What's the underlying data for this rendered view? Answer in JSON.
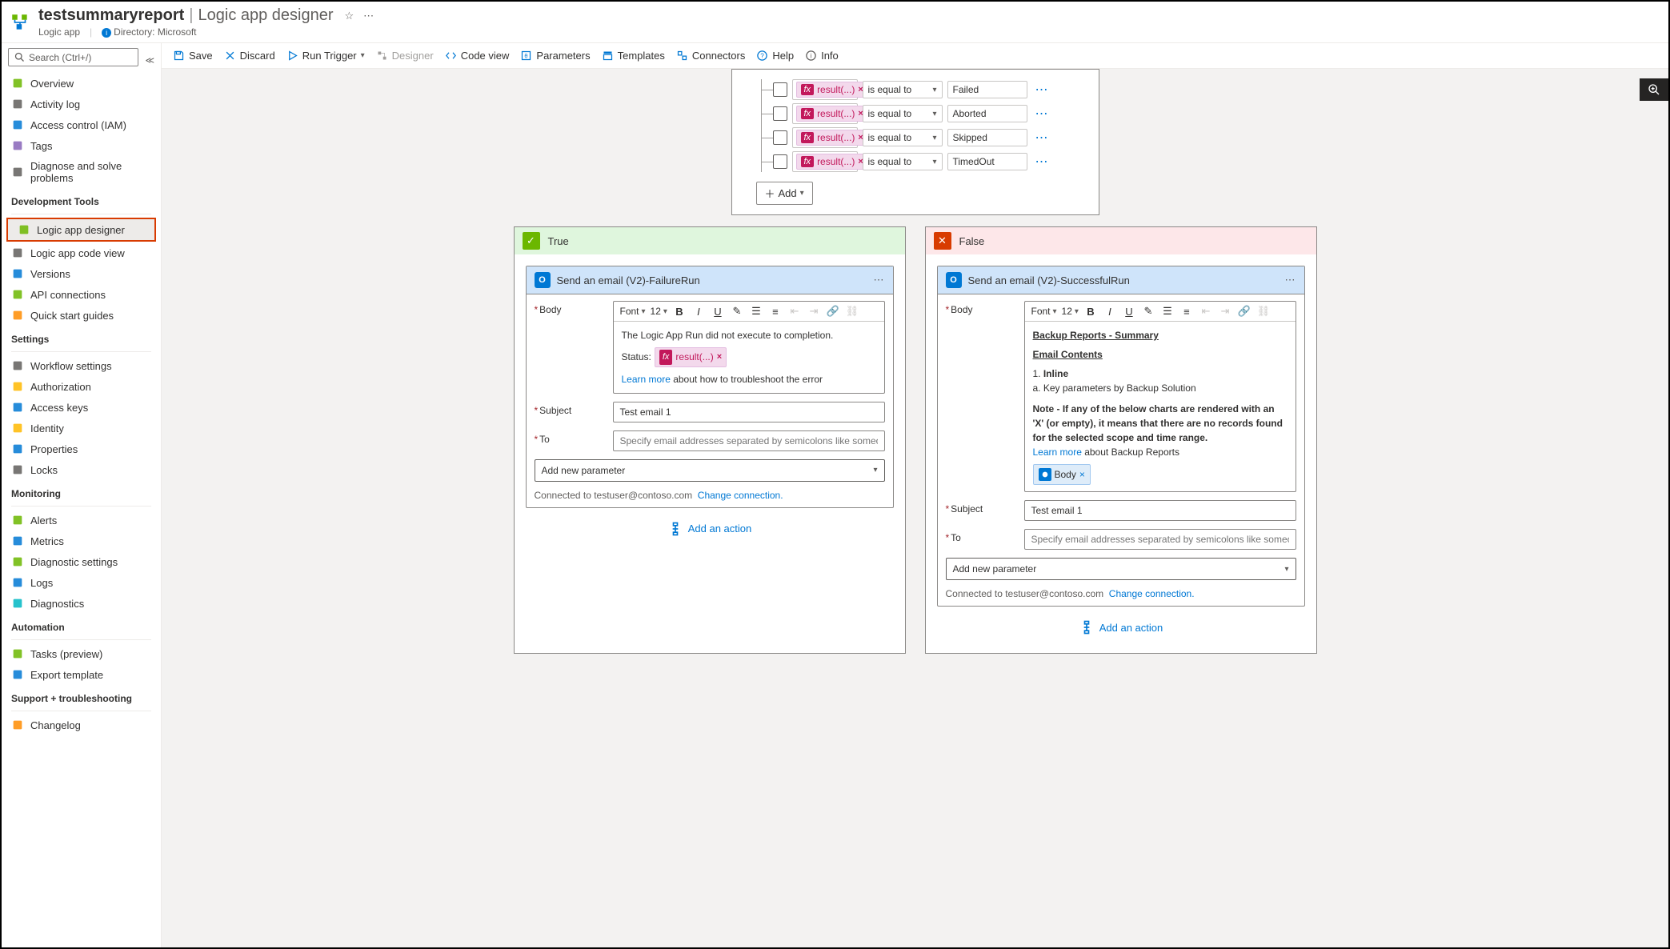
{
  "header": {
    "app_name": "testsummaryreport",
    "page_title": "Logic app designer",
    "resource_type": "Logic app",
    "directory_label": "Directory: Microsoft"
  },
  "sidebar": {
    "search_placeholder": "Search (Ctrl+/)",
    "items_top": [
      {
        "icon": "overview",
        "label": "Overview",
        "color": "#6bb700"
      },
      {
        "icon": "activity",
        "label": "Activity log",
        "color": "#605e5c"
      },
      {
        "icon": "iam",
        "label": "Access control (IAM)",
        "color": "#0078d4"
      },
      {
        "icon": "tags",
        "label": "Tags",
        "color": "#8764b8"
      },
      {
        "icon": "diagnose",
        "label": "Diagnose and solve problems",
        "color": "#605e5c"
      }
    ],
    "section_dev": "Development Tools",
    "items_dev": [
      {
        "icon": "designer",
        "label": "Logic app designer",
        "active": true,
        "color": "#6bb700"
      },
      {
        "icon": "code",
        "label": "Logic app code view",
        "color": "#605e5c"
      },
      {
        "icon": "versions",
        "label": "Versions",
        "color": "#0078d4"
      },
      {
        "icon": "api",
        "label": "API connections",
        "color": "#6bb700"
      },
      {
        "icon": "guides",
        "label": "Quick start guides",
        "color": "#ff8c00"
      }
    ],
    "section_settings": "Settings",
    "items_settings": [
      {
        "icon": "workflow",
        "label": "Workflow settings",
        "color": "#605e5c"
      },
      {
        "icon": "auth",
        "label": "Authorization",
        "color": "#ffb900"
      },
      {
        "icon": "keys",
        "label": "Access keys",
        "color": "#0078d4"
      },
      {
        "icon": "identity",
        "label": "Identity",
        "color": "#ffb900"
      },
      {
        "icon": "props",
        "label": "Properties",
        "color": "#0078d4"
      },
      {
        "icon": "locks",
        "label": "Locks",
        "color": "#605e5c"
      }
    ],
    "section_monitor": "Monitoring",
    "items_monitor": [
      {
        "icon": "alerts",
        "label": "Alerts",
        "color": "#6bb700"
      },
      {
        "icon": "metrics",
        "label": "Metrics",
        "color": "#0078d4"
      },
      {
        "icon": "diagset",
        "label": "Diagnostic settings",
        "color": "#6bb700"
      },
      {
        "icon": "logs",
        "label": "Logs",
        "color": "#0078d4"
      },
      {
        "icon": "diag",
        "label": "Diagnostics",
        "color": "#00b7c3"
      }
    ],
    "section_auto": "Automation",
    "items_auto": [
      {
        "icon": "tasks",
        "label": "Tasks (preview)",
        "color": "#6bb700"
      },
      {
        "icon": "export",
        "label": "Export template",
        "color": "#0078d4"
      }
    ],
    "section_support": "Support + troubleshooting",
    "items_support": [
      {
        "icon": "changelog",
        "label": "Changelog",
        "color": "#ff8c00"
      }
    ]
  },
  "toolbar": {
    "save": "Save",
    "discard": "Discard",
    "run": "Run Trigger",
    "designer": "Designer",
    "codeview": "Code view",
    "params": "Parameters",
    "templates": "Templates",
    "connectors": "Connectors",
    "help": "Help",
    "info": "Info"
  },
  "condition": {
    "token": "result(...)",
    "op": "is equal to",
    "rows": [
      {
        "value": "Failed"
      },
      {
        "value": "Aborted"
      },
      {
        "value": "Skipped"
      },
      {
        "value": "TimedOut"
      }
    ],
    "add": "Add"
  },
  "branch_true": {
    "label": "True",
    "action_title": "Send an email (V2)-FailureRun",
    "body_label": "Body",
    "subject_label": "Subject",
    "to_label": "To",
    "font_label": "Font",
    "font_size": "12",
    "body_text1": "The Logic App Run did not execute to completion.",
    "body_status_prefix": "Status:",
    "body_token": "result(...)",
    "body_learn_more": "Learn more",
    "body_text2": " about how to troubleshoot the error",
    "subject_value": "Test email 1",
    "to_placeholder": "Specify email addresses separated by semicolons like someone@contoso.com",
    "add_param": "Add new parameter",
    "connected": "Connected to testuser@contoso.com",
    "change_conn": "Change connection.",
    "add_action": "Add an action"
  },
  "branch_false": {
    "label": "False",
    "action_title": "Send an email (V2)-SuccessfulRun",
    "body_label": "Body",
    "subject_label": "Subject",
    "to_label": "To",
    "font_label": "Font",
    "font_size": "12",
    "body_h1": "Backup Reports - Summary",
    "body_h2": "Email Contents",
    "body_l1": "1. ",
    "body_l1b": "Inline",
    "body_l2": "a. Key parameters by Backup Solution",
    "body_note_prefix": "Note - ",
    "body_note": "If any of the below charts are rendered with an 'X' (or empty), it means that there are no records found for the selected scope and time range.",
    "body_learn_more": "Learn more",
    "body_learn_suffix": " about Backup Reports",
    "body_token_label": "Body",
    "subject_value": "Test email 1",
    "to_placeholder": "Specify email addresses separated by semicolons like someone@contoso.com",
    "add_param": "Add new parameter",
    "connected": "Connected to testuser@contoso.com",
    "change_conn": "Change connection.",
    "add_action": "Add an action"
  }
}
